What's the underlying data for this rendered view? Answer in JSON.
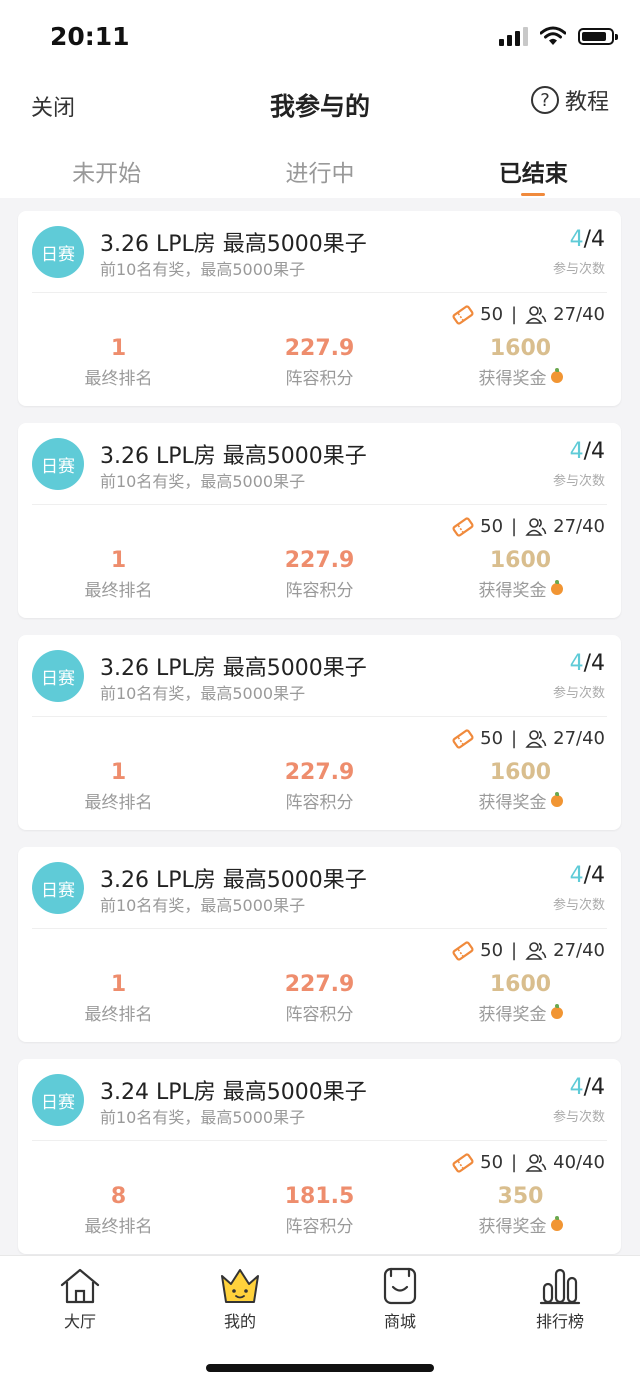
{
  "status": {
    "time": "20:11"
  },
  "nav": {
    "close": "关闭",
    "title": "我参与的",
    "help": "教程"
  },
  "tabs": [
    {
      "label": "未开始",
      "active": false
    },
    {
      "label": "进行中",
      "active": false
    },
    {
      "label": "已结束",
      "active": true
    }
  ],
  "cards": [
    {
      "badge": "日赛",
      "title": "3.26 LPL房 最高5000果子",
      "subtitle": "前10名有奖，最高5000果子",
      "count_current": "4",
      "count_total": "/4",
      "count_label": "参与次数",
      "ticket": "50",
      "sep": "|",
      "players": "27/40",
      "rank": "1",
      "rank_label": "最终排名",
      "score": "227.9",
      "score_label": "阵容积分",
      "prize": "1600",
      "prize_label": "获得奖金"
    },
    {
      "badge": "日赛",
      "title": "3.26 LPL房 最高5000果子",
      "subtitle": "前10名有奖，最高5000果子",
      "count_current": "4",
      "count_total": "/4",
      "count_label": "参与次数",
      "ticket": "50",
      "sep": "|",
      "players": "27/40",
      "rank": "1",
      "rank_label": "最终排名",
      "score": "227.9",
      "score_label": "阵容积分",
      "prize": "1600",
      "prize_label": "获得奖金"
    },
    {
      "badge": "日赛",
      "title": "3.26 LPL房 最高5000果子",
      "subtitle": "前10名有奖，最高5000果子",
      "count_current": "4",
      "count_total": "/4",
      "count_label": "参与次数",
      "ticket": "50",
      "sep": "|",
      "players": "27/40",
      "rank": "1",
      "rank_label": "最终排名",
      "score": "227.9",
      "score_label": "阵容积分",
      "prize": "1600",
      "prize_label": "获得奖金"
    },
    {
      "badge": "日赛",
      "title": "3.26 LPL房 最高5000果子",
      "subtitle": "前10名有奖，最高5000果子",
      "count_current": "4",
      "count_total": "/4",
      "count_label": "参与次数",
      "ticket": "50",
      "sep": "|",
      "players": "27/40",
      "rank": "1",
      "rank_label": "最终排名",
      "score": "227.9",
      "score_label": "阵容积分",
      "prize": "1600",
      "prize_label": "获得奖金"
    },
    {
      "badge": "日赛",
      "title": "3.24 LPL房 最高5000果子",
      "subtitle": "前10名有奖，最高5000果子",
      "count_current": "4",
      "count_total": "/4",
      "count_label": "参与次数",
      "ticket": "50",
      "sep": "|",
      "players": "40/40",
      "rank": "8",
      "rank_label": "最终排名",
      "score": "181.5",
      "score_label": "阵容积分",
      "prize": "350",
      "prize_label": "获得奖金"
    }
  ],
  "tabbar": [
    {
      "label": "大厅",
      "icon": "home-icon"
    },
    {
      "label": "我的",
      "icon": "crown-face-icon"
    },
    {
      "label": "商城",
      "icon": "shop-bag-icon"
    },
    {
      "label": "排行榜",
      "icon": "ranking-bars-icon"
    }
  ],
  "colors": {
    "accent": "#f08a3c",
    "teal": "#5fcbd7",
    "score": "#ee8d6d",
    "prize": "#d9be8e"
  }
}
